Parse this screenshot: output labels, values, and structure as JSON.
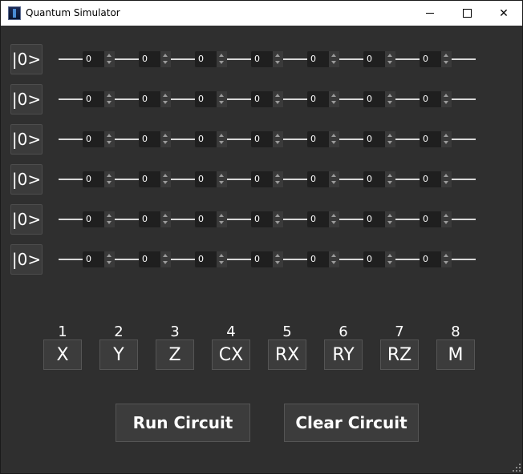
{
  "window": {
    "title": "Quantum Simulator",
    "minimize_glyph": "",
    "close_glyph": "✕"
  },
  "qubits": [
    {
      "label": "|0>",
      "gates": [
        "0",
        "0",
        "0",
        "0",
        "0",
        "0",
        "0"
      ]
    },
    {
      "label": "|0>",
      "gates": [
        "0",
        "0",
        "0",
        "0",
        "0",
        "0",
        "0"
      ]
    },
    {
      "label": "|0>",
      "gates": [
        "0",
        "0",
        "0",
        "0",
        "0",
        "0",
        "0"
      ]
    },
    {
      "label": "|0>",
      "gates": [
        "0",
        "0",
        "0",
        "0",
        "0",
        "0",
        "0"
      ]
    },
    {
      "label": "|0>",
      "gates": [
        "0",
        "0",
        "0",
        "0",
        "0",
        "0",
        "0"
      ]
    },
    {
      "label": "|0>",
      "gates": [
        "0",
        "0",
        "0",
        "0",
        "0",
        "0",
        "0"
      ]
    }
  ],
  "gate_palette": [
    {
      "number": "1",
      "label": "X"
    },
    {
      "number": "2",
      "label": "Y"
    },
    {
      "number": "3",
      "label": "Z"
    },
    {
      "number": "4",
      "label": "CX"
    },
    {
      "number": "5",
      "label": "RX"
    },
    {
      "number": "6",
      "label": "RY"
    },
    {
      "number": "7",
      "label": "RZ"
    },
    {
      "number": "8",
      "label": "M"
    }
  ],
  "actions": {
    "run_label": "Run Circuit",
    "clear_label": "Clear Circuit"
  }
}
